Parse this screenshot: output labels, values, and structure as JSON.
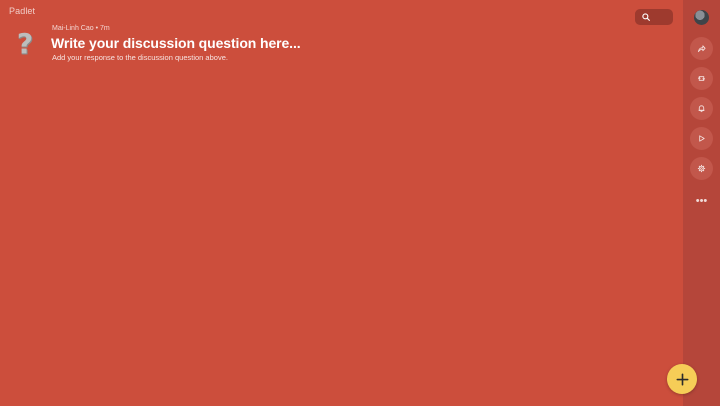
{
  "app": {
    "brand": "Padlet"
  },
  "board": {
    "icon": "question-mark-icon",
    "icon_glyph": "?",
    "author": "Mai-Linh Cao",
    "separator": "•",
    "time": "7m",
    "title": "Write your discussion question here...",
    "subtitle": "Add your response to the discussion question above."
  },
  "toolbar": {
    "search_icon": "search-icon"
  },
  "sidebar": {
    "avatar": "avatar",
    "buttons": [
      "share-icon",
      "remake-icon",
      "bell-icon",
      "play-icon",
      "gear-icon"
    ],
    "more_label": "•••"
  },
  "fab": {
    "icon": "plus-icon"
  },
  "colors": {
    "background": "#cc4e3c",
    "sidebar": "#b5463a",
    "fab": "#f6cd57",
    "search_pill": "#9e3a2e"
  }
}
